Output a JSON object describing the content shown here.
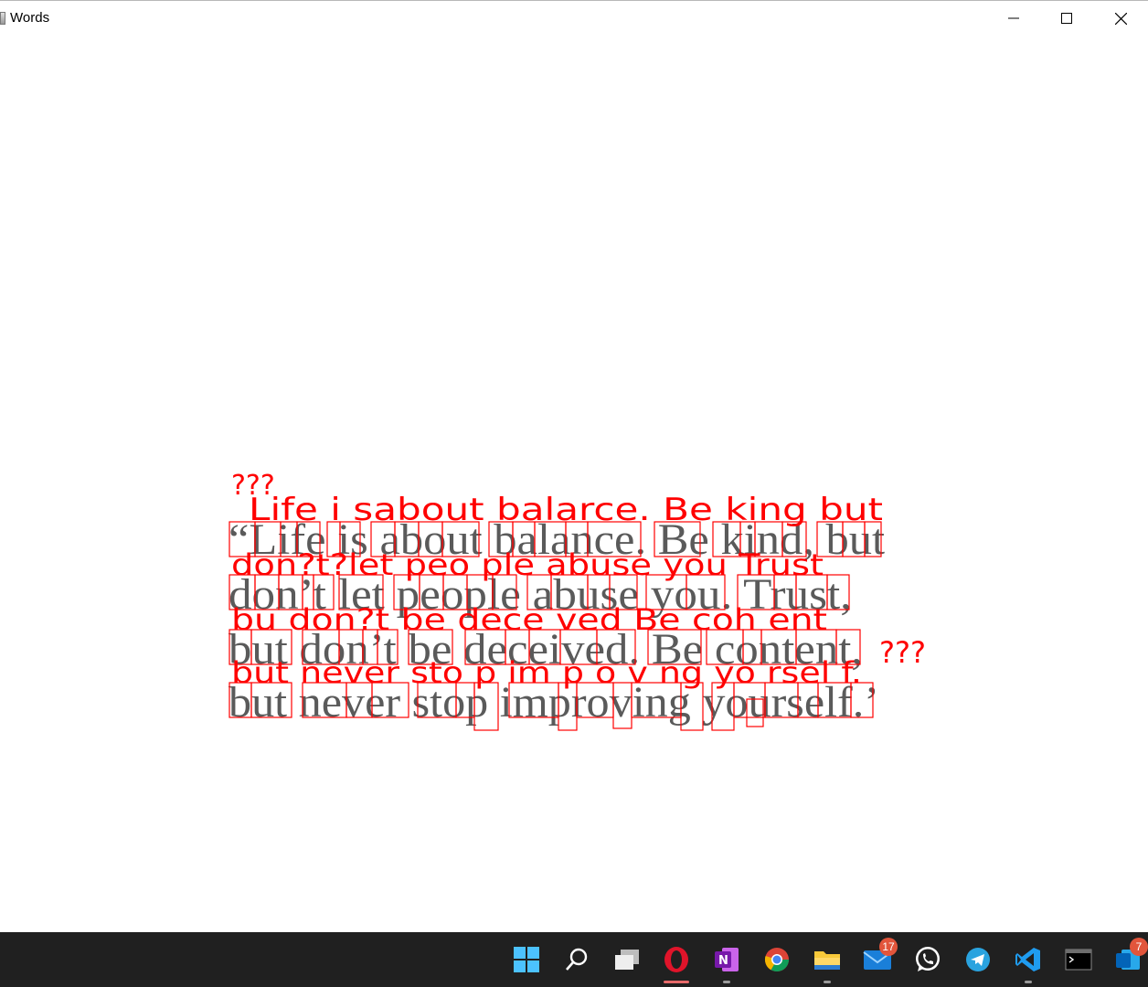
{
  "window": {
    "title": "Words",
    "minimize_label": "minimize",
    "maximize_label": "maximize",
    "close_label": "close"
  },
  "colors": {
    "detection": "#ff0000",
    "text_gray": "#555555",
    "taskbar": "#202020"
  },
  "document": {
    "lines": [
      "“Life is about balance. Be kind, but",
      "don’t let people abuse you. Trust,",
      "but don’t be deceived. Be content,",
      "but never stop improving yourself.’"
    ]
  },
  "ocr_overlay": {
    "lines": [
      "???",
      "Life i sabout balarce.  Be king  but",
      "don?t?let peo ple abuse  you  Trust",
      "bu  don?t be dece ved  Be coh ent",
      "???",
      "but never sto p im p o v ng yo rsel f."
    ]
  },
  "taskbar": {
    "items": [
      {
        "name": "start-icon"
      },
      {
        "name": "search-icon"
      },
      {
        "name": "task-view-icon"
      },
      {
        "name": "opera-icon",
        "active": true
      },
      {
        "name": "onenote-icon"
      },
      {
        "name": "chrome-icon"
      },
      {
        "name": "file-explorer-icon"
      },
      {
        "name": "mail-icon",
        "badge": "17"
      },
      {
        "name": "whatsapp-icon"
      },
      {
        "name": "telegram-icon"
      },
      {
        "name": "vscode-icon"
      },
      {
        "name": "terminal-icon"
      },
      {
        "name": "outlook-icon",
        "badge": "7"
      }
    ]
  }
}
